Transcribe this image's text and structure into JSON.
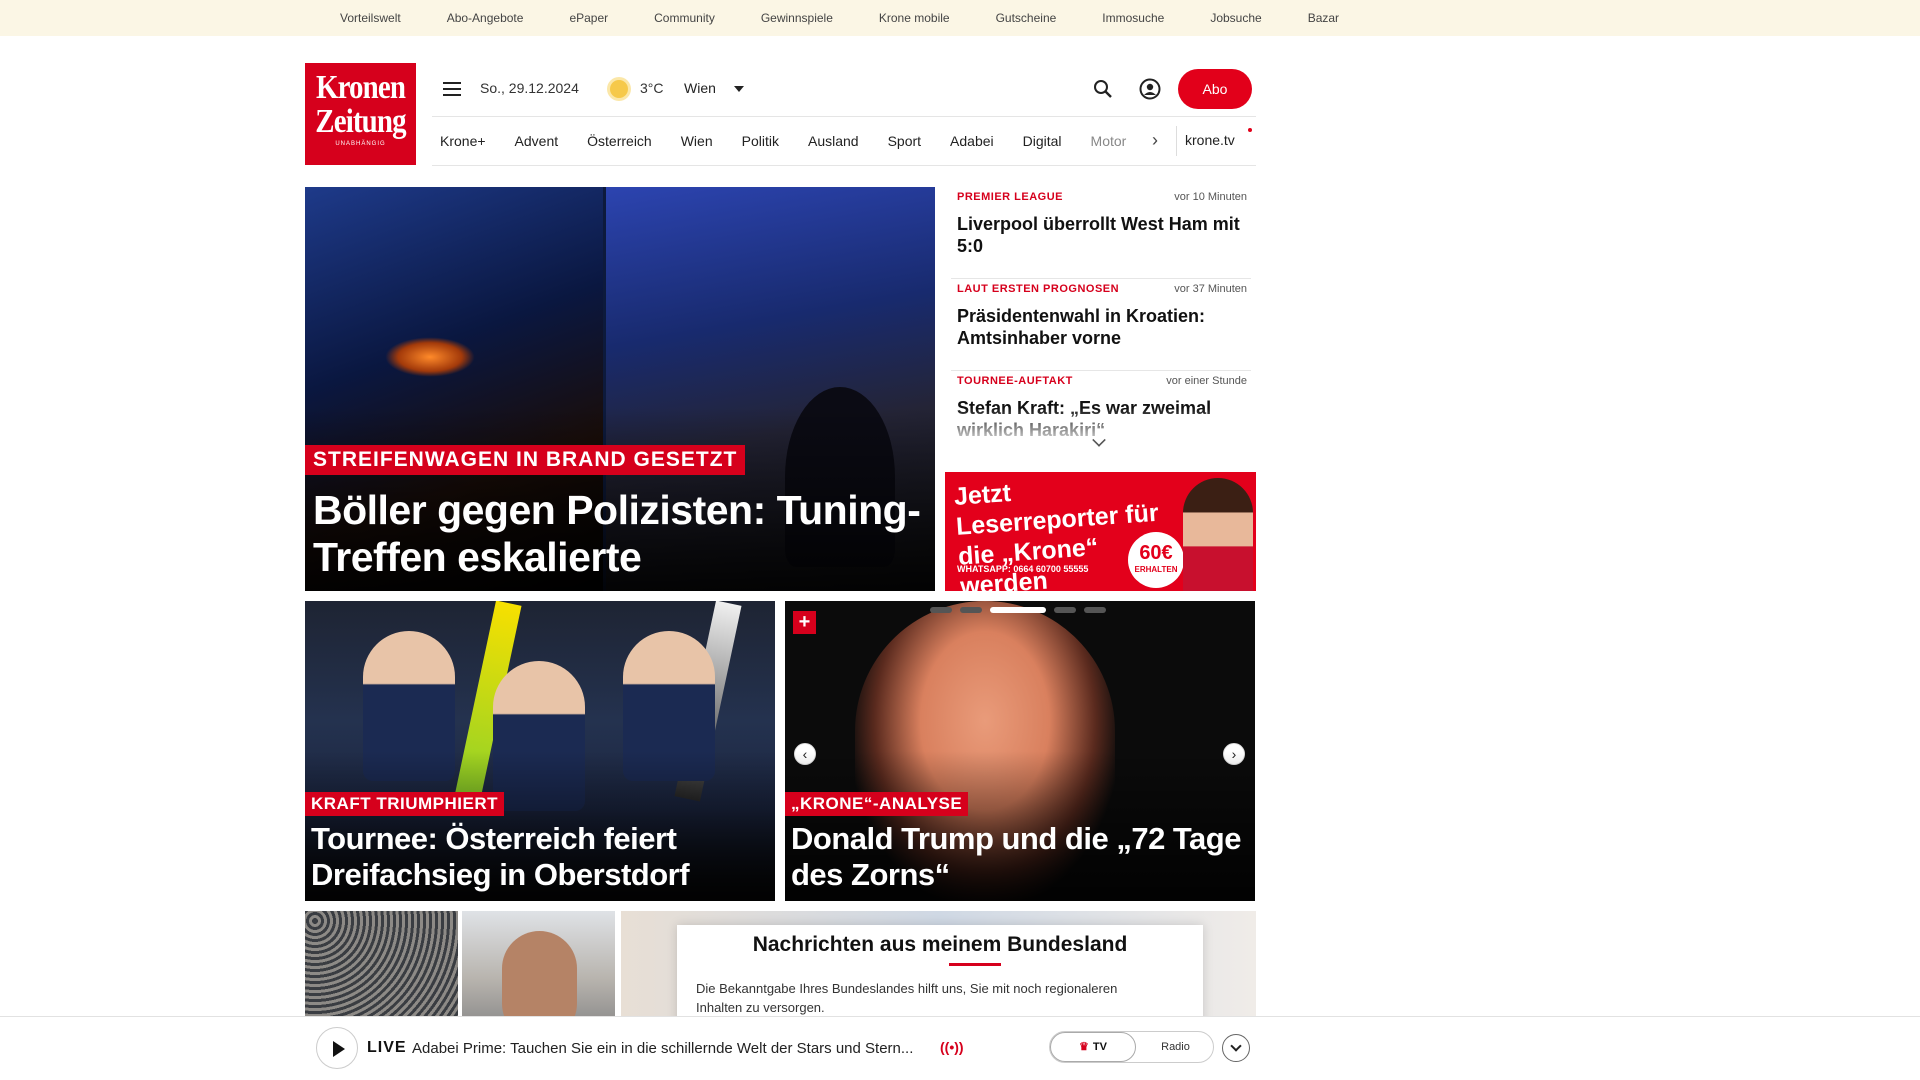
{
  "topbar": {
    "links": [
      "Vorteilswelt",
      "Abo-Angebote",
      "ePaper",
      "Community",
      "Gewinnspiele",
      "Krone mobile",
      "Gutscheine",
      "Immosuche",
      "Jobsuche",
      "Bazar"
    ]
  },
  "header": {
    "logo_line1": "Kronen",
    "logo_line2": "Zeitung",
    "logo_tagline": "UNABHÄNGIG",
    "date": "So., 29.12.2024",
    "temperature": "3°C",
    "city": "Wien",
    "abo_label": "Abo",
    "icons": [
      "menu-icon",
      "sun-icon",
      "search-icon",
      "user-icon"
    ]
  },
  "nav": {
    "items": [
      "Krone+",
      "Advent",
      "Österreich",
      "Wien",
      "Politik",
      "Ausland",
      "Sport",
      "Adabei",
      "Digital",
      "Motor"
    ],
    "tv_label": "krone.tv"
  },
  "hero": {
    "kicker": "STREIFENWAGEN IN BRAND GESETZT",
    "title": "Böller gegen Polizisten: Tuning-Treffen eskalierte"
  },
  "ticker": [
    {
      "category": "PREMIER LEAGUE",
      "time": "vor 10 Minuten",
      "headline": "Liverpool überrollt West Ham mit 5:0"
    },
    {
      "category": "LAUT ERSTEN PROGNOSEN",
      "time": "vor 37 Minuten",
      "headline": "Präsidentenwahl in Kroatien: Amtsinhaber vorne"
    },
    {
      "category": "TOURNEE-AUFTAKT",
      "time": "vor einer Stunde",
      "headline": "Stefan Kraft: „Es war zweimal wirklich Harakiri“"
    }
  ],
  "ad": {
    "headline": "Jetzt Leserreporter für die „Krone“ werden",
    "whatsapp": "WHATSAPP: 0664 60700 55555",
    "badge_amount": "60€",
    "badge_text": "ERHALTEN",
    "accent": "#e3001b"
  },
  "cards": [
    {
      "kicker": "KRAFT TRIUMPHIERT",
      "title": "Tournee: Österreich feiert Dreifachsieg in Oberstdorf"
    },
    {
      "kicker": "„KRONE“-ANALYSE",
      "title": "Donald Trump und die „72 Tage des Zorns“",
      "plus": "+"
    }
  ],
  "modal": {
    "title": "Nachrichten aus meinem Bundesland",
    "text": "Die Bekanntgabe Ihres Bundeslandes hilft uns, Sie mit noch regionaleren Inhalten zu versorgen."
  },
  "player": {
    "live_label": "LIVE",
    "text": "Adabei Prime: Tauchen Sie ein in die schillernde Welt der Stars und Stern...",
    "tv_label": "TV",
    "radio_label": "Radio"
  },
  "colors": {
    "brand_red": "#d6001c",
    "topbar_bg": "#fbf6e5"
  }
}
